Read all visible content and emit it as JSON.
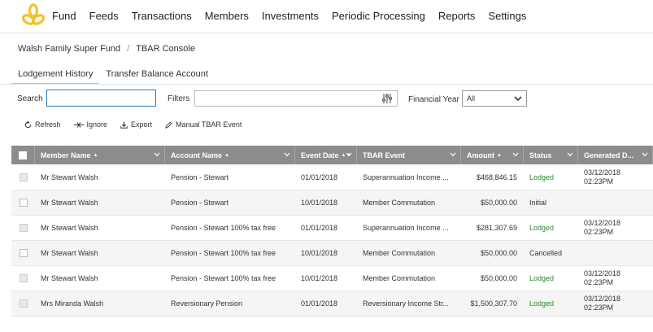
{
  "nav": {
    "items": [
      "Fund",
      "Feeds",
      "Transactions",
      "Members",
      "Investments",
      "Periodic Processing",
      "Reports",
      "Settings"
    ]
  },
  "breadcrumb": {
    "fund": "Walsh Family Super Fund",
    "separator": "/",
    "page": "TBAR Console"
  },
  "tabs": [
    {
      "label": "Lodgement History",
      "active": true
    },
    {
      "label": "Transfer Balance Account",
      "active": false
    }
  ],
  "filters": {
    "search_label": "Search",
    "search_value": "",
    "filters_label": "Filters",
    "filters_value": "",
    "fy_label": "Financial Year",
    "fy_value": "All"
  },
  "toolbar": {
    "refresh": "Refresh",
    "ignore": "Ignore",
    "export": "Export",
    "manual": "Manual TBAR Event"
  },
  "table": {
    "columns": [
      "Member Name",
      "Account Name",
      "Event Date",
      "TBAR Event",
      "Amount",
      "Status",
      "Generated D..."
    ],
    "rows": [
      {
        "member": "Mr Stewart Walsh",
        "account": "Pension - Stewart",
        "date": "01/01/2018",
        "event": "Superannuation Income ...",
        "amount": "$468,846.15",
        "status": "Lodged",
        "gen_date": "03/12/2018",
        "gen_time": "02:23PM",
        "disabled": true
      },
      {
        "member": "Mr Stewart Walsh",
        "account": "Pension - Stewart",
        "date": "10/01/2018",
        "event": "Member Commutation",
        "amount": "$50,000.00",
        "status": "Initial",
        "gen_date": "",
        "gen_time": "",
        "disabled": false
      },
      {
        "member": "Mr Stewart Walsh",
        "account": "Pension - Stewart 100% tax free",
        "date": "01/01/2018",
        "event": "Superannuation Income ...",
        "amount": "$281,307.69",
        "status": "Lodged",
        "gen_date": "03/12/2018",
        "gen_time": "02:23PM",
        "disabled": true
      },
      {
        "member": "Mr Stewart Walsh",
        "account": "Pension - Stewart 100% tax free",
        "date": "10/01/2018",
        "event": "Member Commutation",
        "amount": "$50,000.00",
        "status": "Cancelled",
        "gen_date": "",
        "gen_time": "",
        "disabled": false
      },
      {
        "member": "Mr Stewart Walsh",
        "account": "Pension - Stewart 100% tax free",
        "date": "10/01/2018",
        "event": "Member Commutation",
        "amount": "$50,000.00",
        "status": "Lodged",
        "gen_date": "03/12/2018",
        "gen_time": "02:23PM",
        "disabled": true
      },
      {
        "member": "Mrs Miranda Walsh",
        "account": "Reversionary Pension",
        "date": "01/01/2018",
        "event": "Reversionary Income Str...",
        "amount": "$1,500,307.70",
        "status": "Lodged",
        "gen_date": "03/12/2018",
        "gen_time": "02:23PM",
        "disabled": true
      }
    ]
  },
  "colors": {
    "accent": "#f2c12e",
    "header_bg": "#8c8c8c",
    "lodged": "#2e8b2e",
    "search_border": "#2b7bb9"
  }
}
